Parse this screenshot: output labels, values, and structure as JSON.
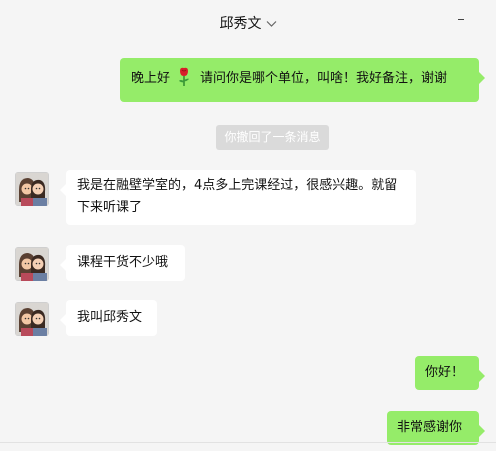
{
  "header": {
    "title": "邱秀文",
    "dropdown_icon": "chevron-down-icon",
    "minimize_icon": "minimize-icon"
  },
  "messages": [
    {
      "side": "right",
      "text_before": "晚上好",
      "emoji": "rose-emoji",
      "text_after": "请问你是哪个单位，叫啥！我好备注，谢谢"
    },
    {
      "system": "你撤回了一条消息"
    },
    {
      "side": "left",
      "text": "我是在融壁学室的，4点多上完课经过，很感兴趣。就留下来听课了"
    },
    {
      "side": "left",
      "text": "课程干货不少哦"
    },
    {
      "side": "left",
      "text": "我叫邱秀文"
    },
    {
      "side": "right",
      "text": "你好！"
    },
    {
      "side": "right",
      "text": "非常感谢你"
    }
  ],
  "colors": {
    "sent_bubble": "#95ec69",
    "received_bubble": "#ffffff",
    "background": "#f5f5f5",
    "system_notice": "#dadada"
  }
}
